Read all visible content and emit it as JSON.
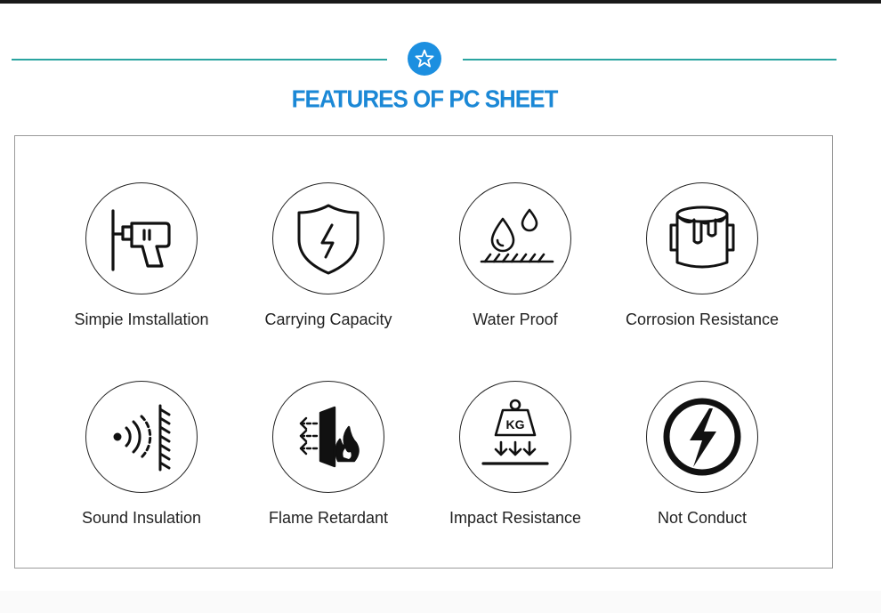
{
  "header": {
    "title": "FEATURES OF PC SHEET"
  },
  "colors": {
    "accent": "#1b88d6",
    "rule": "#2aa4a0",
    "icon": "#111111"
  },
  "features": [
    {
      "label": "Simpie Imstallation",
      "icon": "drill-icon"
    },
    {
      "label": "Carrying Capacity",
      "icon": "shield-lightning-icon"
    },
    {
      "label": "Water Proof",
      "icon": "water-drops-icon"
    },
    {
      "label": "Corrosion Resistance",
      "icon": "paint-bucket-icon"
    },
    {
      "label": "Sound Insulation",
      "icon": "sound-wall-icon"
    },
    {
      "label": "Flame Retardant",
      "icon": "flame-barrier-icon"
    },
    {
      "label": "Impact Resistance",
      "icon": "weight-kg-icon"
    },
    {
      "label": "Not Conduct",
      "icon": "no-electricity-icon"
    }
  ],
  "weight_text": "KG"
}
